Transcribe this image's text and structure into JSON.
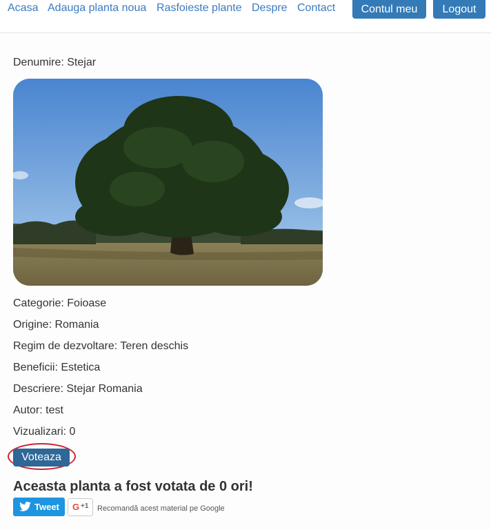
{
  "nav": {
    "links": [
      "Acasa",
      "Adauga planta noua",
      "Rasfoieste plante",
      "Despre",
      "Contact"
    ],
    "account_button": "Contul meu",
    "logout_button": "Logout"
  },
  "plant": {
    "name_label": "Denumire: Stejar",
    "image": "oak-tree-photo",
    "category_label": "Categorie: Foioase",
    "origin_label": "Origine: Romania",
    "growth_label": "Regim de dezvoltare: Teren deschis",
    "benefits_label": "Beneficii: Estetica",
    "description_label": "Descriere: Stejar Romania",
    "author_label": "Autor: test",
    "views_label": "Vizualizari: 0"
  },
  "vote": {
    "button_label": "Voteaza",
    "votes_text": "Aceasta planta a fost votata de 0 ori!"
  },
  "social": {
    "tweet_label": "Tweet",
    "gplus_g": "G",
    "gplus_count": "+1",
    "gplus_text": "Recomandă acest material pe Google"
  },
  "colors": {
    "link": "#3a7bbf",
    "primary_button": "#337ab7",
    "vote_button": "#2f6796",
    "highlight_ring": "#d0202a",
    "tweet": "#1d95e0",
    "gplus": "#dd4b39"
  }
}
